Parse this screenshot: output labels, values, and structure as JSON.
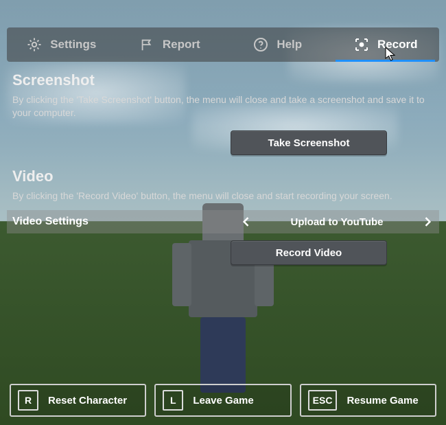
{
  "tabs": {
    "settings": "Settings",
    "report": "Report",
    "help": "Help",
    "record": "Record",
    "active": "record",
    "accent_color": "#1e90ff"
  },
  "screenshot": {
    "title": "Screenshot",
    "desc": "By clicking the 'Take Screenshot' button, the menu will close and take a screenshot and save it to your computer.",
    "button": "Take Screenshot"
  },
  "video": {
    "title": "Video",
    "desc": "By clicking the 'Record Video' button, the menu will close and start recording your screen.",
    "setting_label": "Video Settings",
    "setting_value": "Upload to YouTube",
    "button": "Record Video"
  },
  "actions": {
    "reset": {
      "key": "R",
      "label": "Reset Character"
    },
    "leave": {
      "key": "L",
      "label": "Leave Game"
    },
    "resume": {
      "key": "ESC",
      "label": "Resume Game"
    }
  }
}
